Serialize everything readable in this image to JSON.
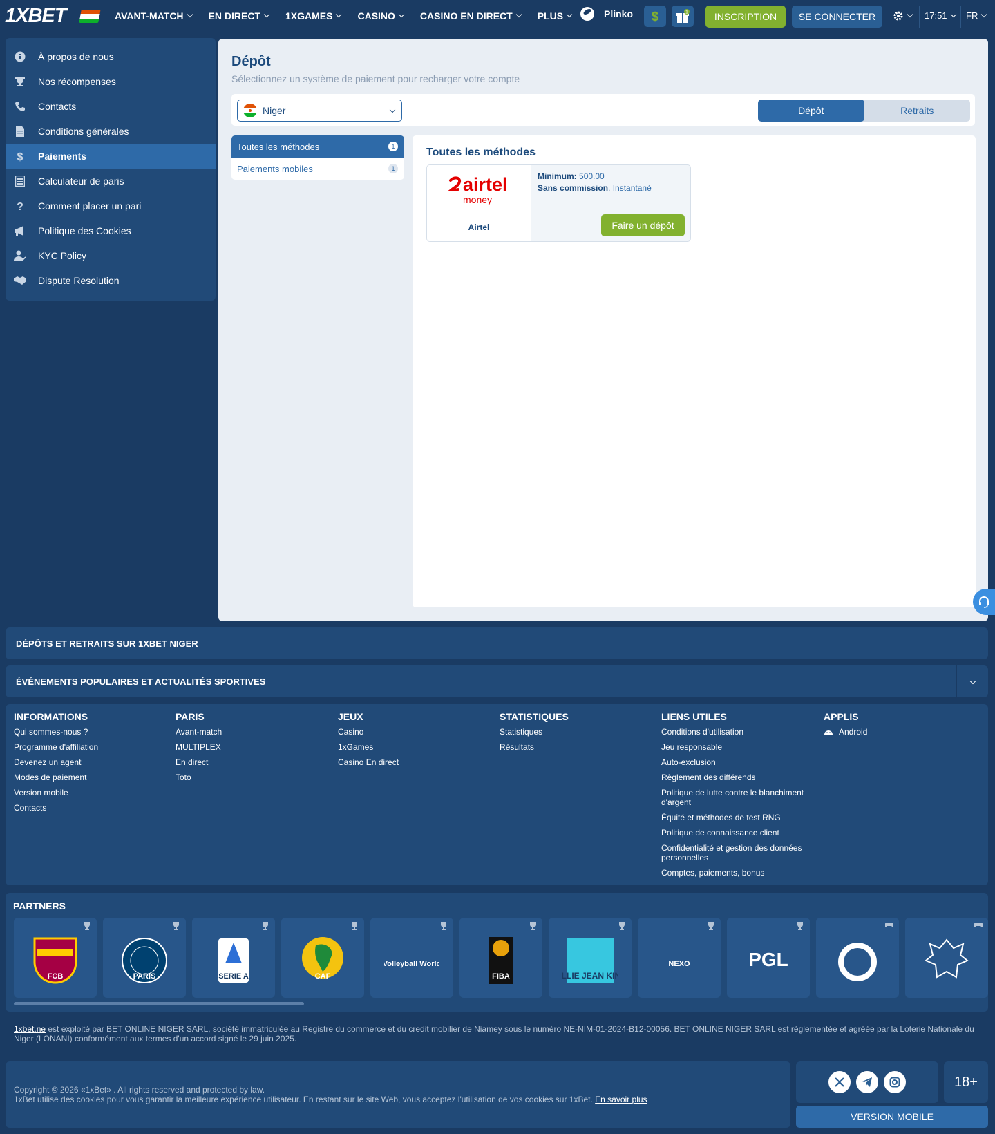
{
  "header": {
    "logo": "1XBET",
    "nav": [
      "AVANT-MATCH",
      "EN DIRECT",
      "1XGAMES",
      "CASINO",
      "CASINO EN DIRECT",
      "PLUS"
    ],
    "plinko": "Plinko",
    "gift_badge": "1",
    "register": "INSCRIPTION",
    "login": "SE CONNECTER",
    "time": "17:51",
    "lang": "FR"
  },
  "sidebar": {
    "items": [
      {
        "label": "À propos de nous",
        "icon": "info-icon"
      },
      {
        "label": "Nos récompenses",
        "icon": "trophy-icon"
      },
      {
        "label": "Contacts",
        "icon": "phone-icon"
      },
      {
        "label": "Conditions générales",
        "icon": "document-icon"
      },
      {
        "label": "Paiements",
        "icon": "dollar-icon"
      },
      {
        "label": "Calculateur de paris",
        "icon": "calculator-icon"
      },
      {
        "label": "Comment placer un pari",
        "icon": "question-icon"
      },
      {
        "label": "Politique des Cookies",
        "icon": "megaphone-icon"
      },
      {
        "label": "KYC Policy",
        "icon": "user-check-icon"
      },
      {
        "label": "Dispute Resolution",
        "icon": "handshake-icon"
      }
    ],
    "active_index": 4
  },
  "main": {
    "title": "Dépôt",
    "subtitle": "Sélectionnez un système de paiement pour recharger votre compte",
    "country": "Niger",
    "tabs": [
      "Dépôt",
      "Retraits"
    ],
    "categories": [
      {
        "label": "Toutes les méthodes",
        "count": "1"
      },
      {
        "label": "Paiements mobiles",
        "count": "1"
      }
    ],
    "panel_title": "Toutes les méthodes",
    "method": {
      "logo_word": "airtel",
      "logo_sub": "money",
      "name": "Airtel",
      "min_label": "Minimum:",
      "min_value": "500.00",
      "commission": "Sans commission",
      "speed": "Instantané",
      "button": "Faire un dépôt"
    }
  },
  "bands": {
    "deposits": "DÉPÔTS ET RETRAITS SUR 1XBET NIGER",
    "events": "ÉVÉNEMENTS POPULAIRES ET ACTUALITÉS SPORTIVES"
  },
  "footer": {
    "columns": [
      {
        "title": "INFORMATIONS",
        "links": [
          "Qui sommes-nous ?",
          "Programme d'affiliation",
          "Devenez un agent",
          "Modes de paiement",
          "Version mobile",
          "Contacts"
        ]
      },
      {
        "title": "PARIS",
        "links": [
          "Avant-match",
          "MULTIPLEX",
          "En direct",
          "Toto"
        ]
      },
      {
        "title": "JEUX",
        "links": [
          "Casino",
          "1xGames",
          "Casino En direct"
        ]
      },
      {
        "title": "STATISTIQUES",
        "links": [
          "Statistiques",
          "Résultats"
        ]
      },
      {
        "title": "LIENS UTILES",
        "links": [
          "Conditions d'utilisation",
          "Jeu responsable",
          "Auto-exclusion",
          "Règlement des différends",
          "Politique de lutte contre le blanchiment d'argent",
          "Équité et méthodes de test RNG",
          "Politique de connaissance client",
          "Confidentialité et gestion des données personnelles",
          "Comptes, paiements, bonus"
        ]
      },
      {
        "title": "APPLIS",
        "links": [
          "Android"
        ]
      }
    ]
  },
  "partners": {
    "title": "PARTNERS",
    "logos": [
      {
        "icon": "fc-barcelona-logo",
        "text": "FCB"
      },
      {
        "icon": "psg-logo",
        "text": "PARIS"
      },
      {
        "icon": "serie-a-logo",
        "text": "SERIE A"
      },
      {
        "icon": "caf-logo",
        "text": "CAF"
      },
      {
        "icon": "volleyball-world-logo",
        "text": "Volleyball World"
      },
      {
        "icon": "fiba-logo",
        "text": "FIBA"
      },
      {
        "icon": "billie-jean-king-cup-logo",
        "text": "BILLIE JEAN KING"
      },
      {
        "icon": "nexo-open-logo",
        "text": "NEXO"
      },
      {
        "icon": "pgl-logo",
        "text": "PGL"
      },
      {
        "icon": "esports-team-logo",
        "text": ""
      },
      {
        "icon": "dragon-team-logo",
        "text": ""
      }
    ]
  },
  "legal": {
    "site": "1xbet.ne",
    "text": " est exploité par BET ONLINE NIGER SARL, société immatriculée au Registre du commerce et du credit mobilier de Niamey sous le numéro NE-NIM-01-2024-B12-00056. BET ONLINE NIGER SARL est réglementée et agréée par la Loterie Nationale du Niger (LONANI) conformément aux termes d'un accord signé le 29 juin 2025."
  },
  "copyright": {
    "line1": "Copyright © 2026 «1xBet» . All rights reserved and protected by law.",
    "line2": "1xBet utilise des cookies pour vous garantir la meilleure expérience utilisateur. En restant sur le site Web, vous acceptez l'utilisation de vos cookies sur 1xBet. ",
    "more": "En savoir plus",
    "age": "18+",
    "mobile": "VERSION MOBILE"
  },
  "colors": {
    "brand_dark": "#1a3b63",
    "panel": "#214a78",
    "accent": "#2e6aa8",
    "green": "#82b12f",
    "airtel_red": "#e40000"
  }
}
